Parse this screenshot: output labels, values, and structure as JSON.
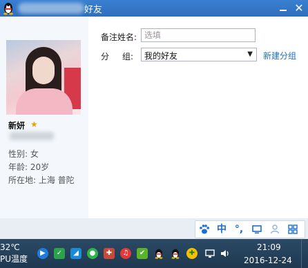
{
  "window": {
    "title": "好友"
  },
  "profile": {
    "nickname": "新妍",
    "gender": "性别: 女",
    "age": "年龄: 20岁",
    "location": "所在地: 上海  普陀"
  },
  "form": {
    "remark_label": "备注姓名:",
    "remark_placeholder": "选填",
    "group_label_a": "分",
    "group_label_b": "组:",
    "group_value": "我的好友",
    "new_group_link": "新建分组"
  },
  "ime_toolbar": {
    "lang": "中",
    "punct": "°,"
  },
  "taskbar": {
    "temperature": "32℃",
    "temperature_label": "PU温度",
    "time": "21:09",
    "date": "2016-12-24"
  },
  "colors": {
    "titlebar": "#3a7fd1",
    "link": "#1e6fc4",
    "ime_accent": "#1a6fd0",
    "taskbar": "#1f3850"
  }
}
